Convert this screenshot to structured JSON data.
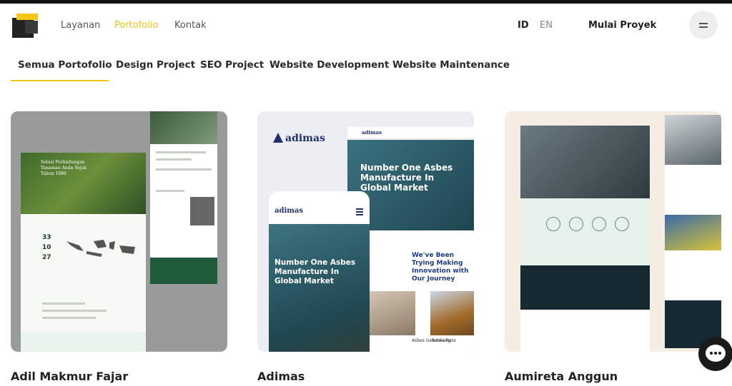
{
  "header": {
    "nav": [
      {
        "label": "Layanan",
        "active": false
      },
      {
        "label": "Portofolio",
        "active": true
      },
      {
        "label": "Kontak",
        "active": false
      }
    ],
    "lang": {
      "id": "ID",
      "en": "EN"
    },
    "cta_label": "Mulai Proyek",
    "menu_icon": "hamburger-icon"
  },
  "filters": {
    "tabs": [
      {
        "label": "Semua Portofolio",
        "active": true
      },
      {
        "label": "Design Project",
        "active": false
      },
      {
        "label": "SEO Project",
        "active": false
      },
      {
        "label": "Website Development",
        "active": false
      },
      {
        "label": "Website Maintenance",
        "active": false
      }
    ]
  },
  "portfolio": [
    {
      "title": "Adil Makmur Fajar",
      "hero_text": "Solusi Perlindungan Tanaman Anda Sejak Tahun 1986",
      "stats": [
        "33",
        "10",
        "27"
      ]
    },
    {
      "title": "Adimas",
      "brand": "adimas",
      "headline": "Number One Asbes Manufacture In Global Market",
      "subheadline": "We've Been Trying Making Innovation with Our Journey",
      "captions": [
        "Asbes Gelombang",
        "Asbes Rata"
      ]
    },
    {
      "title": "Aumireta Anggun"
    }
  ],
  "theme": {
    "accent": "#f5c518",
    "dark": "#222222"
  },
  "chat": {
    "icon": "chat-icon"
  }
}
